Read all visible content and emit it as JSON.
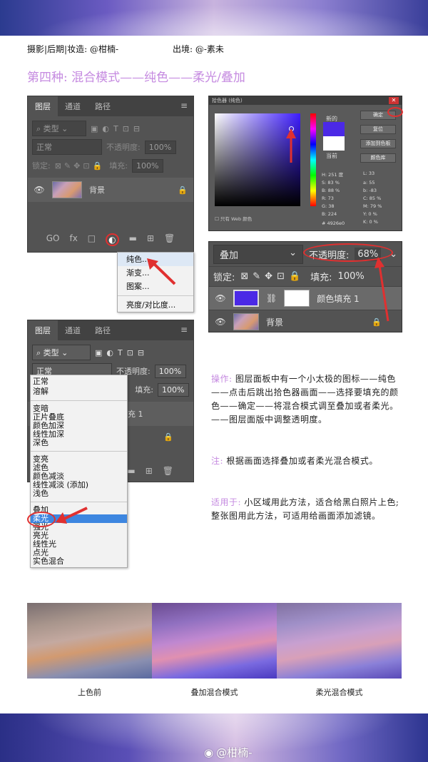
{
  "header": {
    "credit_left": "摄影|后期|妆造: @柑楠-",
    "credit_right": "出境: @-素未"
  },
  "section_title": "第四种: 混合模式——纯色——柔光/叠加",
  "layers_panel_1": {
    "tabs": [
      "图层",
      "通道",
      "路径"
    ],
    "kind_label": "类型",
    "mode": "正常",
    "opacity_label": "不透明度:",
    "opacity_value": "100%",
    "lock_label": "锁定:",
    "fill_label": "填充:",
    "fill_value": "100%",
    "layer_name": "背景",
    "bottom_icons": [
      "GO",
      "fx",
      "□",
      "◐",
      "▬",
      "⊞",
      "🗑"
    ],
    "popup_items": [
      "纯色...",
      "渐变...",
      "图案...",
      "亮度/对比度..."
    ]
  },
  "color_picker": {
    "title": "拾色器 (纯色)",
    "new_label": "新的",
    "current_label": "当前",
    "buttons": [
      "确定",
      "复位",
      "添加到色板",
      "颜色库"
    ],
    "values": [
      "H: 251 度",
      "L: 33",
      "S: 83 %",
      "a: 55",
      "B: 88 %",
      "b: -83",
      "R: 73",
      "C: 85 %",
      "G: 38",
      "M: 79 %",
      "B: 224",
      "Y: 0 %",
      "",
      "K: 0 %"
    ],
    "hex": "# 4926e0",
    "web_only": "只有 Web 颜色"
  },
  "layers_zoom": {
    "mode": "叠加",
    "opacity_label": "不透明度:",
    "opacity_value": "68%",
    "lock_label": "锁定:",
    "fill_label": "填充:",
    "fill_value": "100%",
    "layer_fill_name": "颜色填充 1",
    "layer_bg_name": "背景"
  },
  "layers_panel_2": {
    "tabs": [
      "图层",
      "通道",
      "路径"
    ],
    "kind_label": "类型",
    "mode": "正常",
    "opacity_label": "不透明度:",
    "opacity_value": "100%",
    "fill_label": "填充:",
    "fill_value": "100%",
    "partial_layer": "充 1",
    "blend_groups": [
      [
        "正常",
        "溶解"
      ],
      [
        "变暗",
        "正片叠底",
        "颜色加深",
        "线性加深",
        "深色"
      ],
      [
        "变亮",
        "滤色",
        "颜色减淡",
        "线性减淡 (添加)",
        "浅色"
      ],
      [
        "叠加",
        "柔光",
        "强光",
        "亮光",
        "线性光",
        "点光",
        "实色混合"
      ]
    ]
  },
  "instructions": {
    "op_label": "操作:",
    "op_text": "图层面板中有一个小太极的图标——纯色——点击后跳出拾色器画面——选择要填充的颜色——确定——将混合模式调至叠加或者柔光。——图层面版中调整透明度。",
    "note_label": "注:",
    "note_text": "根据画面选择叠加或者柔光混合模式。",
    "use_label": "适用于:",
    "use_text": "小区域用此方法，适合给黑白照片上色; 整张图用此方法，可适用给画面添加滤镜。"
  },
  "comparison": {
    "captions": [
      "上色前",
      "叠加混合模式",
      "柔光混合模式"
    ]
  },
  "watermark": "@柑楠-"
}
